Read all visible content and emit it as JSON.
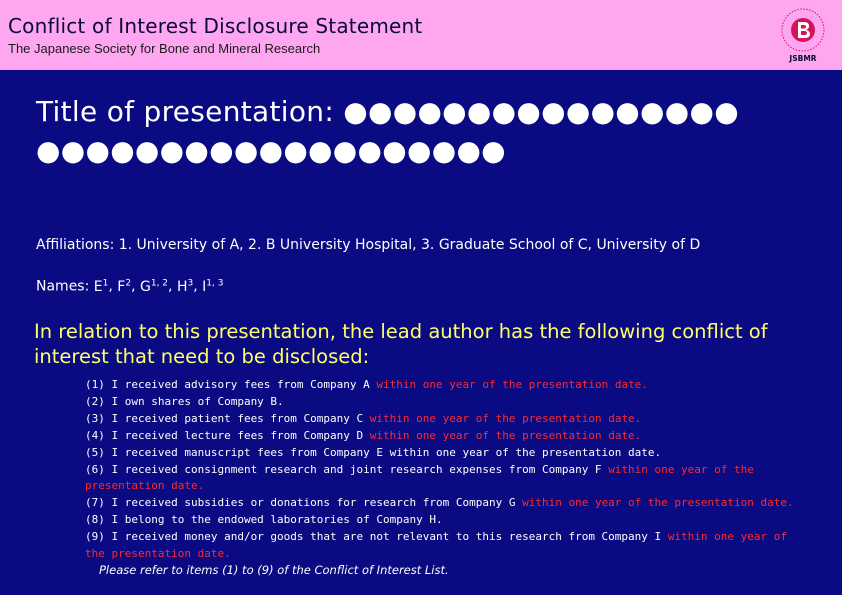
{
  "header": {
    "title": "Conflict of Interest Disclosure Statement",
    "subtitle": "The Japanese Society for Bone and Mineral Research",
    "logo_text": "JSBMR"
  },
  "presentation": {
    "title": "Title of presentation: ●●●●●●●●●●●●●●●● ●●●●●●●●●●●●●●●●●●●",
    "affiliations": "Affiliations: 1. University of A, 2. B University Hospital, 3. Graduate School of C, University of D",
    "names_label": "Names:",
    "names": [
      {
        "name": "E",
        "sup": "1"
      },
      {
        "name": "F",
        "sup": "2"
      },
      {
        "name": "G",
        "sup": "1, 2"
      },
      {
        "name": "H",
        "sup": "3"
      },
      {
        "name": "I",
        "sup": "1, 3"
      }
    ]
  },
  "disclosure": {
    "intro": "In relation to this presentation, the lead author has the following conflict of interest that need to be disclosed:",
    "items": [
      {
        "text": "(1) I received advisory fees from Company A",
        "highlight": "within one year of the presentation date."
      },
      {
        "text": "(2) I own shares of Company B.",
        "highlight": ""
      },
      {
        "text": "(3) I received patient fees from Company C",
        "highlight": "within one year of the presentation date."
      },
      {
        "text": "(4) I received lecture fees from Company D",
        "highlight": "within one year of the presentation date."
      },
      {
        "text": "(5) I received manuscript fees from Company E within one year of the presentation date.",
        "highlight": ""
      },
      {
        "text": "(6) I received consignment research and joint research expenses from Company F",
        "highlight": "within one year of the presentation date."
      },
      {
        "text": "(7) I received subsidies or donations for research from Company G",
        "highlight": "within one year of the presentation date."
      },
      {
        "text": "(8) I belong to the endowed laboratories of Company H.",
        "highlight": ""
      },
      {
        "text": "(9) I received money and/or goods that are not relevant to this research from Company I",
        "highlight": "within one year of the presentation date."
      }
    ],
    "note": "Please refer to items (1) to (9) of the Conflict of Interest List."
  },
  "colors": {
    "background": "#0a0a82",
    "header": "#ffa6f0",
    "highlight": "#ff2a2a",
    "intro": "#ffff66",
    "logo": "#d4145a"
  },
  "icons": {
    "logo": "jsbmr-logo-icon"
  }
}
